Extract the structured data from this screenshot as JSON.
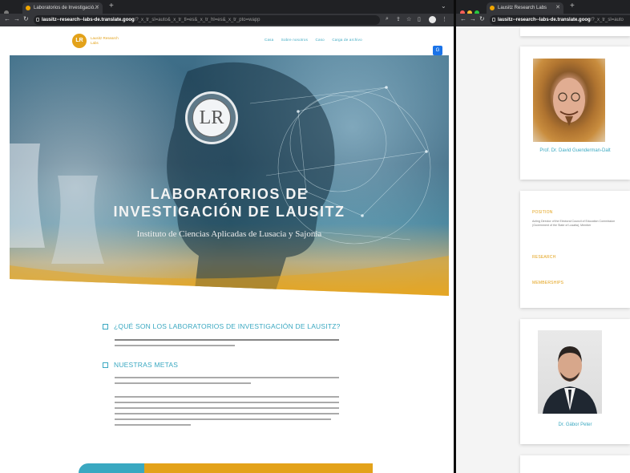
{
  "left_window": {
    "tab_title": "Laboratorios de Investigació...",
    "url_host": "lausitz--research--labs-de.translate.goog",
    "url_rest": "/?_x_tr_sl=auto&_x_tr_tl=es&_x_tr_hl=es&_x_tr_pto=wapp",
    "site": {
      "logo_initials": "LR",
      "logo_text": "Lausitz Research Labs",
      "nav": [
        "Casa",
        "Sobre nosotros",
        "Caso",
        "Carga de archivo"
      ],
      "hero": {
        "logo_initials": "LR",
        "title_line1": "LABORATORIOS DE",
        "title_line2": "INVESTIGACIÓN DE LAUSITZ",
        "subtitle": "Instituto de Ciencias Aplicadas de Lusacia y Sajonia"
      },
      "sections": [
        {
          "heading": "¿QUÉ SON LOS LABORATORIOS DE INVESTIGACIÓN DE LAUSITZ?"
        },
        {
          "heading": "NUESTRAS METAS"
        }
      ]
    }
  },
  "right_window": {
    "tab_title": "Lausitz Research Labs",
    "url_host": "lausitz--research--labs-de.translate.goog",
    "url_rest": "/?_x_tr_sl=auto",
    "profile1_name": "Prof. Dr. David Guenderman-Dalt",
    "profile_card": {
      "position_label": "POSITION",
      "position_text": "Acting Director of the Electoral Council of Education Commission (Government of the State of Lusatia), Member",
      "research_label": "RESEARCH",
      "memberships_label": "MEMBERSHIPS"
    },
    "profile2_name": "Dr. Gábor Peter"
  },
  "colors": {
    "accent_teal": "#3aa8c1",
    "accent_gold": "#e3a21a"
  }
}
